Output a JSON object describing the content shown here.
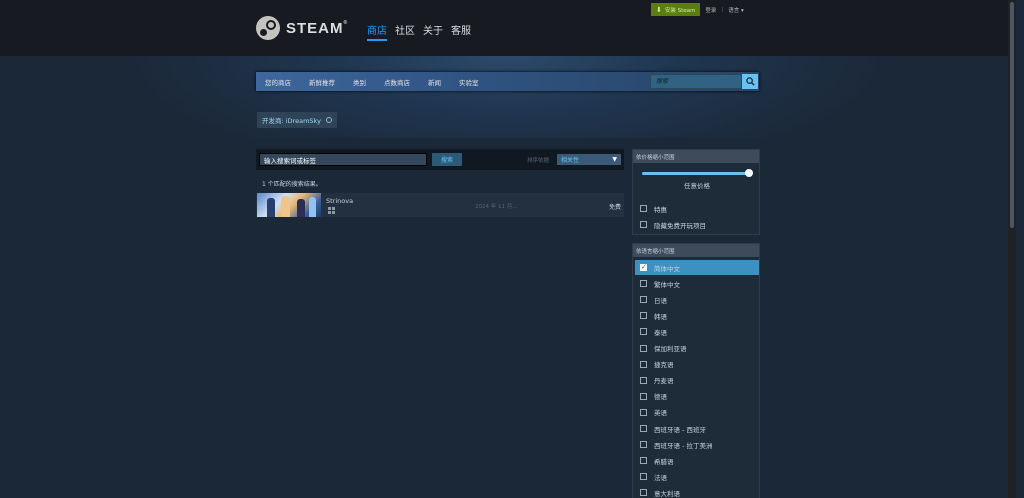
{
  "header": {
    "logo_text": "STEAM",
    "logo_reg": "®",
    "nav": [
      "商店",
      "社区",
      "关于",
      "客服"
    ],
    "install_label": "安装 Steam",
    "login_label": "登录",
    "separator": "|",
    "language_label": "语言 ▾"
  },
  "store_nav": {
    "items": [
      "您的商店",
      "新鲜推荐",
      "类别",
      "点数商店",
      "新闻",
      "实验室"
    ],
    "search_placeholder": "搜索"
  },
  "filter_tag": {
    "label": "开发商: iDreamSky"
  },
  "search": {
    "input_value": "输入搜索词或标签",
    "button_label": "搜索",
    "sort_label": "排序依据",
    "sort_value": "相关性",
    "results_count": "1 个匹配的搜索结果。"
  },
  "results": [
    {
      "title": "Strinova",
      "platform_icon": "windows-icon",
      "date": "2024 年 11 月...",
      "price": "免费"
    }
  ],
  "price_filter": {
    "header": "依价格缩小范围",
    "price_label": "任意价格",
    "slider_fraction": 1.0,
    "options": [
      {
        "label": "特惠",
        "checked": false
      },
      {
        "label": "隐藏免费开玩项目",
        "checked": false
      }
    ]
  },
  "lang_filter": {
    "header": "依语言缩小范围",
    "options": [
      {
        "label": "简体中文",
        "checked": true
      },
      {
        "label": "繁体中文",
        "checked": false
      },
      {
        "label": "日语",
        "checked": false
      },
      {
        "label": "韩语",
        "checked": false
      },
      {
        "label": "泰语",
        "checked": false
      },
      {
        "label": "保加利亚语",
        "checked": false
      },
      {
        "label": "捷克语",
        "checked": false
      },
      {
        "label": "丹麦语",
        "checked": false
      },
      {
        "label": "德语",
        "checked": false
      },
      {
        "label": "英语",
        "checked": false
      },
      {
        "label": "西班牙语 - 西班牙",
        "checked": false
      },
      {
        "label": "西班牙语 - 拉丁美洲",
        "checked": false
      },
      {
        "label": "希腊语",
        "checked": false
      },
      {
        "label": "法语",
        "checked": false
      },
      {
        "label": "意大利语",
        "checked": false
      }
    ]
  },
  "colors": {
    "background": "#1b2838",
    "header_bg": "#171a21",
    "accent": "#67c1f5",
    "install_green": "#5c7e10",
    "checked_row": "#3c91c0"
  }
}
